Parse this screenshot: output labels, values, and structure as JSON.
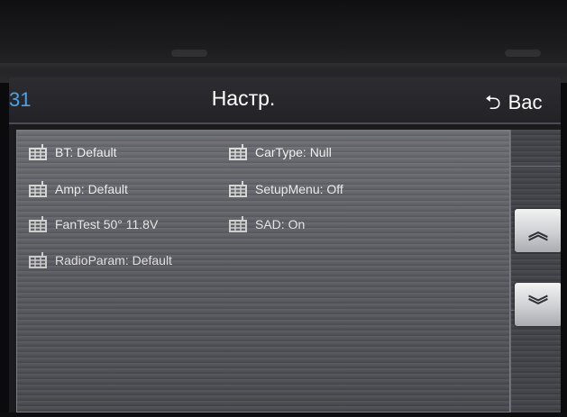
{
  "header": {
    "left_text": "31",
    "title": "Настр.",
    "back_label": "Bac"
  },
  "menu": {
    "left": [
      {
        "label": "BT: Default",
        "icon": "grid-icon"
      },
      {
        "label": "Amp: Default",
        "icon": "grid-icon"
      },
      {
        "label": "FanTest 50° 11.8V",
        "icon": "grid-icon"
      },
      {
        "label": "RadioParam: Default",
        "icon": "grid-icon"
      }
    ],
    "right": [
      {
        "label": "CarType: Null",
        "icon": "grid-icon"
      },
      {
        "label": "SetupMenu: Off",
        "icon": "grid-icon"
      },
      {
        "label": "SAD: On",
        "icon": "grid-icon"
      }
    ]
  },
  "scroll": {
    "up_icon": "double-chevron-up-icon",
    "down_icon": "double-chevron-down-icon"
  },
  "colors": {
    "accent": "#4aa3e8",
    "text": "#f2f2f2"
  }
}
